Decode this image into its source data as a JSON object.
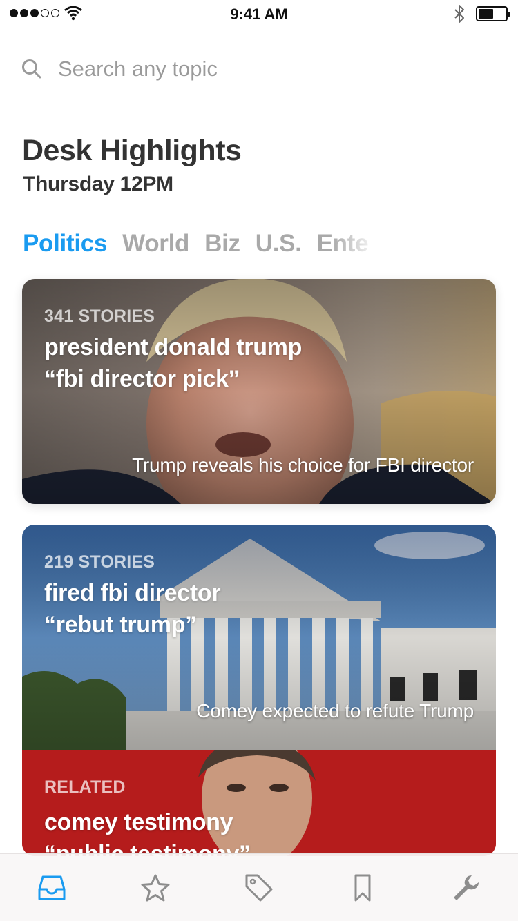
{
  "status_bar": {
    "time": "9:41 AM"
  },
  "search": {
    "placeholder": "Search any topic"
  },
  "header": {
    "title": "Desk Highlights",
    "subtitle": "Thursday 12PM"
  },
  "tabs": [
    {
      "label": "Politics",
      "active": true
    },
    {
      "label": "World",
      "active": false
    },
    {
      "label": "Biz",
      "active": false
    },
    {
      "label": "U.S.",
      "active": false
    },
    {
      "label": "Ente",
      "active": false
    }
  ],
  "cards": [
    {
      "count": "341 STORIES",
      "headline_line1": "president donald trump",
      "headline_line2": "“fbi director pick”",
      "caption": "Trump reveals his choice for FBI director"
    },
    {
      "count": "219 STORIES",
      "headline_line1": "fired fbi director",
      "headline_line2": "“rebut trump”",
      "caption": "Comey expected to refute Trump"
    }
  ],
  "related": {
    "label": "RELATED",
    "headline_line1": "comey testimony",
    "headline_line2": "“public testimony”"
  },
  "tab_bar": {
    "items": [
      {
        "icon": "inbox-icon",
        "active": true
      },
      {
        "icon": "star-icon",
        "active": false
      },
      {
        "icon": "tag-icon",
        "active": false
      },
      {
        "icon": "bookmark-icon",
        "active": false
      },
      {
        "icon": "wrench-icon",
        "active": false
      }
    ]
  },
  "colors": {
    "accent": "#1a9bf0",
    "inactive_tab": "#a9a9a9",
    "related_red": "#b51c1c"
  }
}
